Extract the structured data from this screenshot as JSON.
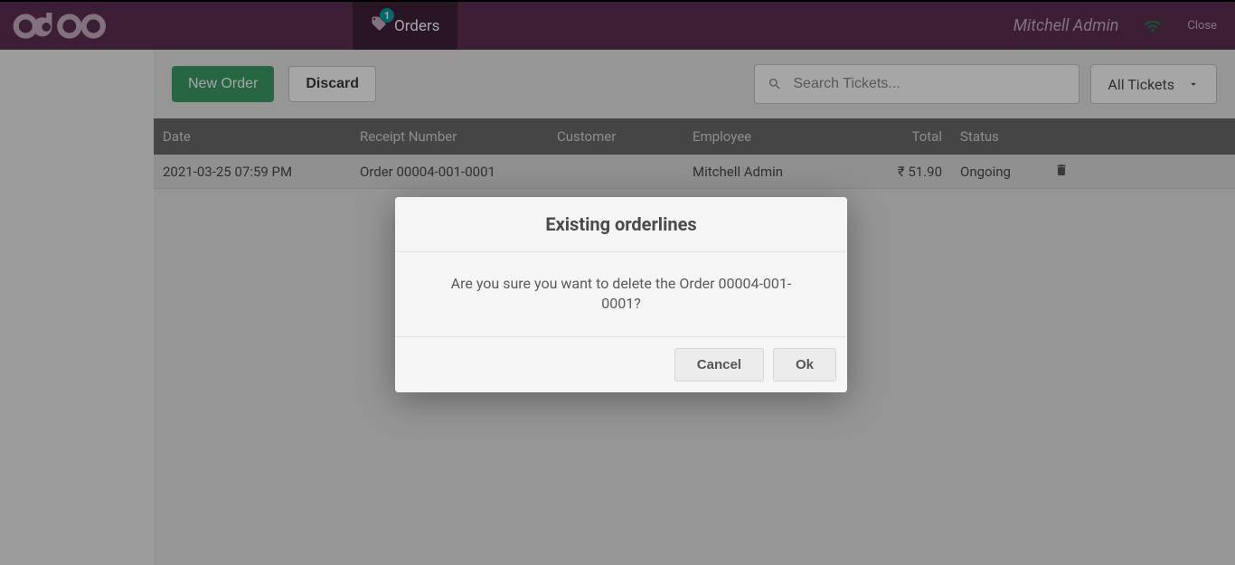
{
  "header": {
    "orders_tab_label": "Orders",
    "orders_badge": 1,
    "username": "Mitchell Admin",
    "close_label": "Close"
  },
  "toolbar": {
    "new_order_label": "New Order",
    "discard_label": "Discard",
    "search_placeholder": "Search Tickets...",
    "filter_label": "All Tickets"
  },
  "table": {
    "columns": {
      "date": "Date",
      "receipt": "Receipt Number",
      "customer": "Customer",
      "employee": "Employee",
      "total": "Total",
      "status": "Status"
    },
    "rows": [
      {
        "date": "2021-03-25 07:59 PM",
        "receipt": "Order 00004-001-0001",
        "customer": "",
        "employee": "Mitchell Admin",
        "total": "₹ 51.90",
        "status": "Ongoing"
      }
    ]
  },
  "modal": {
    "title": "Existing orderlines",
    "body": "Are you sure you want to delete the Order 00004-001-0001?",
    "cancel": "Cancel",
    "ok": "Ok"
  }
}
